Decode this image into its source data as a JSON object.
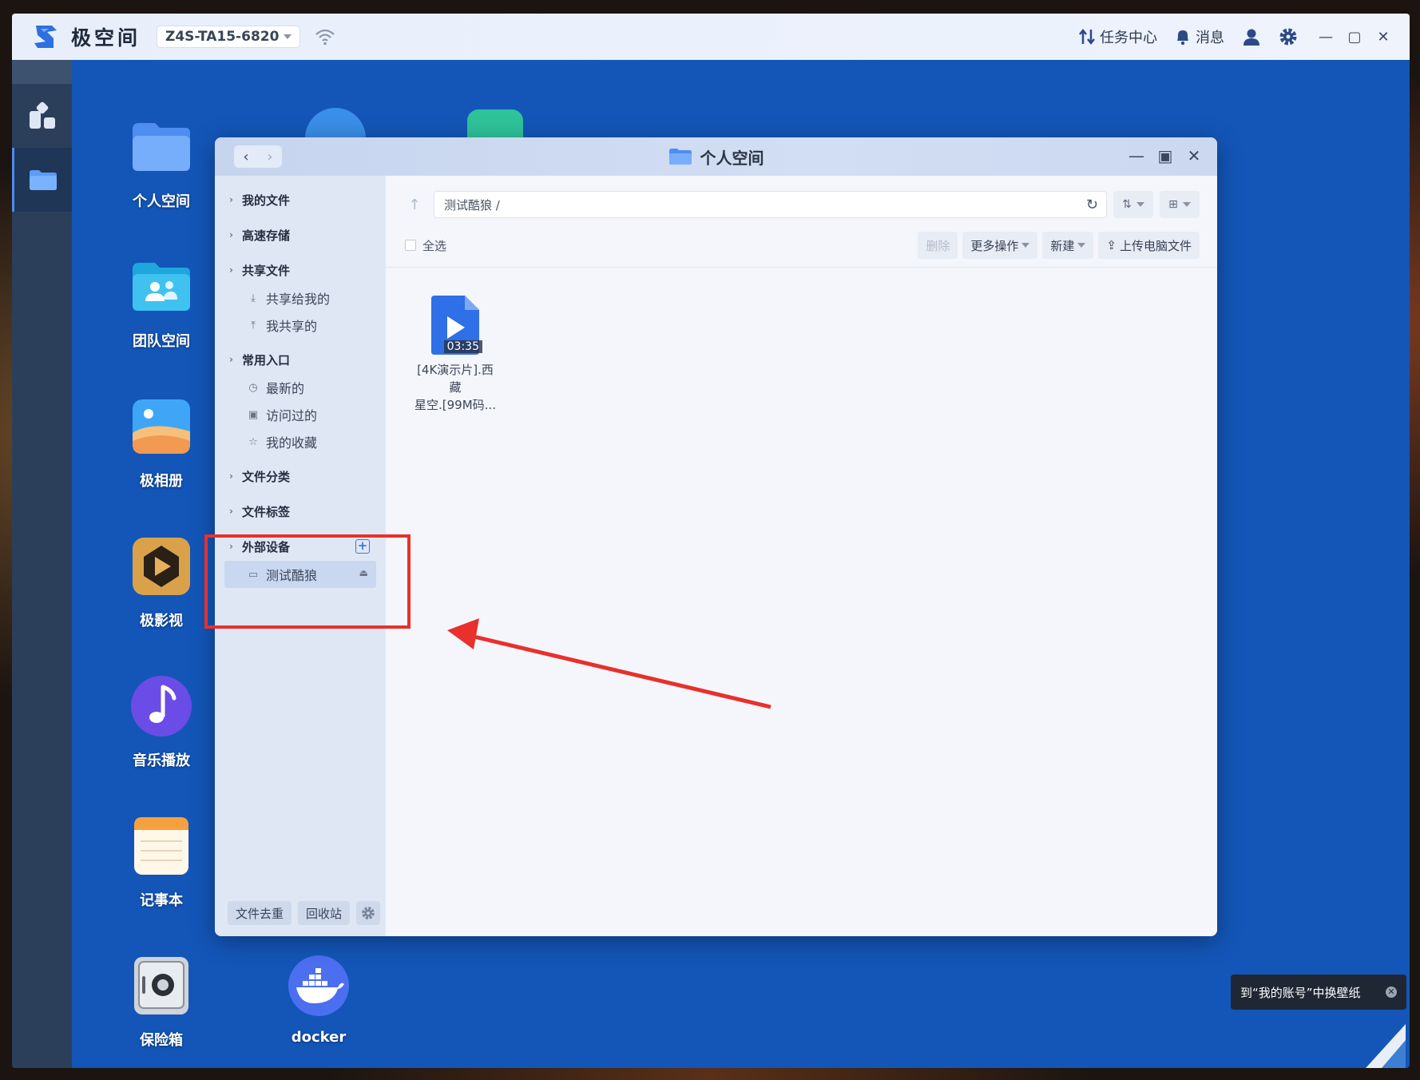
{
  "topbar": {
    "app_name": "极空间",
    "device_name": "Z4S-TA15-6820",
    "task_center": "任务中心",
    "messages": "消息"
  },
  "desktop": {
    "icons": [
      {
        "label": "个人空间"
      },
      {
        "label": "团队空间"
      },
      {
        "label": "极相册"
      },
      {
        "label": "极影视"
      },
      {
        "label": "音乐播放"
      },
      {
        "label": "记事本"
      },
      {
        "label": "保险箱"
      },
      {
        "label": "docker"
      }
    ]
  },
  "file_window": {
    "title": "个人空间",
    "sidebar": {
      "my_files": "我的文件",
      "fast_storage": "高速存储",
      "shared_files": "共享文件",
      "shared_to_me": "共享给我的",
      "my_shared": "我共享的",
      "common_entry": "常用入口",
      "recent": "最新的",
      "visited": "访问过的",
      "favorites": "我的收藏",
      "file_category": "文件分类",
      "file_tags": "文件标签",
      "external_devices": "外部设备",
      "device_item": "测试酷狼",
      "dedupe": "文件去重",
      "recycle": "回收站"
    },
    "path": "测试酷狼 /",
    "actions": {
      "select_all": "全选",
      "delete": "删除",
      "more": "更多操作",
      "new": "新建",
      "upload": "上传电脑文件"
    },
    "files": [
      {
        "name_line1": "[4K演示片].西藏",
        "name_line2": "星空.[99M码...",
        "duration": "03:35"
      }
    ]
  },
  "toast": {
    "text": "到“我的账号”中换壁纸"
  },
  "colors": {
    "accent": "#3a78e0",
    "highlight": "#e8302c",
    "desktop": "#1356b8"
  }
}
